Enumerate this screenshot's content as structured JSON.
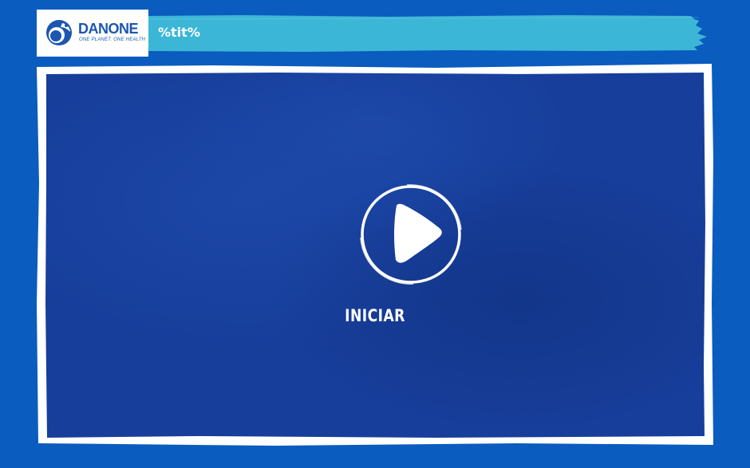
{
  "header": {
    "logo": {
      "name": "DANONE",
      "tagline": "ONE PLANET. ONE HEALTH",
      "icon": "danone-logo-icon"
    },
    "title": "%tit%"
  },
  "player": {
    "play_icon": "play-icon",
    "start_label": "INICIAR"
  },
  "colors": {
    "background": "#0a5cbf",
    "title_bar": "#3cb6d6",
    "video_area": "#173e9b",
    "frame": "#ffffff"
  }
}
